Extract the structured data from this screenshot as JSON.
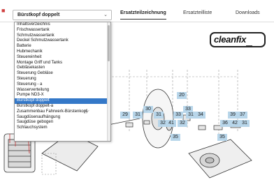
{
  "header": {
    "select_value": "Bürstkopf doppelt",
    "tabs": [
      {
        "label": "Ersatzteilzeichnung",
        "active": true
      },
      {
        "label": "Ersatzteilliste",
        "active": false
      },
      {
        "label": "Downloads",
        "active": false
      }
    ]
  },
  "dropdown": {
    "options": [
      "Inhaltsverzeichnis",
      "Frischwassertank",
      "Schmutzwassertank",
      "Deckel Schmutzwassertank",
      "Batterie",
      "Hubmechanik",
      "Steuereinheit",
      "Montage Griff und Tanks",
      "Gebläsekasten",
      "Steuerung Gebläse",
      "Steuerung",
      "Steuerung - a",
      "Wasserverteilung",
      "Pumpe ND3-X",
      "Bürstkopf doppelt",
      "Bürstkopf doppelt-a",
      "Zusammenbau Fahrwerk-Bürstenkopf",
      "Saugdüsenaufhängung",
      "Saugdüse gebogen",
      "Schlauchsystem"
    ],
    "selected_index": 14
  },
  "logo": {
    "text": "cleanfix"
  },
  "callouts": [
    "20",
    "30",
    "33",
    "29",
    "31",
    "31",
    "33",
    "31",
    "34",
    "39",
    "37",
    "32",
    "41",
    "32",
    "36",
    "42",
    "31",
    "35",
    "35"
  ],
  "colors": {
    "callout": "#b8d6ea",
    "selected": "#3478c8"
  }
}
